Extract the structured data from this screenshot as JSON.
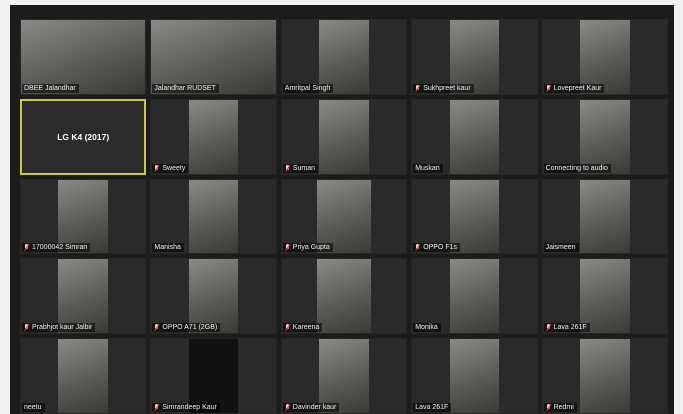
{
  "meeting": {
    "active_speaker_label": "LG K4 (2017)"
  },
  "participants": [
    {
      "name": "DBEE Jalandhar",
      "muted": false,
      "video": "full"
    },
    {
      "name": "Jalandhar RUDSET",
      "muted": false,
      "video": "full"
    },
    {
      "name": "Amritpal Singh",
      "muted": false,
      "video": "center"
    },
    {
      "name": "Sukhpreet kaur",
      "muted": true,
      "video": "center"
    },
    {
      "name": "Lovepreet Kaur",
      "muted": true,
      "video": "center"
    },
    {
      "name": "LG K4 (2017)",
      "muted": false,
      "video": "none",
      "active": true
    },
    {
      "name": "Sweety",
      "muted": true,
      "video": "center"
    },
    {
      "name": "Suman",
      "muted": true,
      "video": "center"
    },
    {
      "name": "Muskan",
      "muted": false,
      "video": "center"
    },
    {
      "name": "Connecting to audio",
      "muted": false,
      "video": "center"
    },
    {
      "name": "17000042 Simran",
      "muted": true,
      "video": "center"
    },
    {
      "name": "Manisha",
      "muted": false,
      "video": "center"
    },
    {
      "name": "Priya Gupta",
      "muted": true,
      "video": "wide"
    },
    {
      "name": "OPPO F1s",
      "muted": true,
      "video": "center"
    },
    {
      "name": "Jaismeen",
      "muted": false,
      "video": "center"
    },
    {
      "name": "Prabhjot kaur Jalbir",
      "muted": true,
      "video": "center"
    },
    {
      "name": "OPPO A71 (2GB)",
      "muted": true,
      "video": "center"
    },
    {
      "name": "Kareena",
      "muted": true,
      "video": "wide"
    },
    {
      "name": "Monika",
      "muted": false,
      "video": "center"
    },
    {
      "name": "Lava 261F",
      "muted": true,
      "video": "center"
    },
    {
      "name": "neetu",
      "muted": false,
      "video": "center"
    },
    {
      "name": "Simrandeep Kaur",
      "muted": true,
      "video": "dark"
    },
    {
      "name": "Davinder kaur",
      "muted": true,
      "video": "center"
    },
    {
      "name": "Lava 261F",
      "muted": false,
      "video": "center"
    },
    {
      "name": "Redmi",
      "muted": true,
      "video": "center"
    }
  ],
  "colors": {
    "active_border": "#c6cc3d",
    "mute_red": "#e0332a",
    "tile_bg": "#2a2a2a"
  }
}
